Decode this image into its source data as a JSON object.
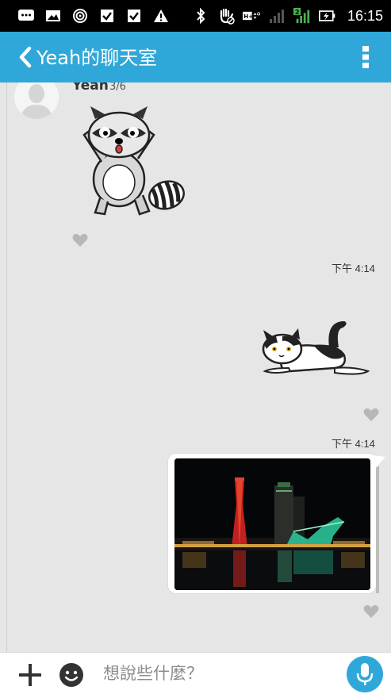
{
  "status_bar": {
    "time": "16:15",
    "icons_left": [
      "chat-bubble-icon",
      "image-icon",
      "hotspot-icon",
      "checkbox-icon",
      "checkbox-icon",
      "warning-icon"
    ],
    "icons_right": [
      "bluetooth-icon",
      "hand-icon",
      "network-hplus-icon",
      "signal-icon",
      "signal-2-icon",
      "battery-charging-icon"
    ]
  },
  "app_bar": {
    "title": "Yeah的聊天室",
    "background": "#2fa8d9"
  },
  "chat": {
    "sender": {
      "name": "Yeah",
      "count": "3/6"
    },
    "messages": [
      {
        "type": "sticker",
        "side": "left",
        "icon": "raccoon-sticker"
      },
      {
        "type": "sticker",
        "side": "right",
        "icon": "cat-sticker",
        "time": "下午 4:14"
      },
      {
        "type": "photo",
        "side": "right",
        "icon": "night-harbor-photo",
        "time": "下午 4:14"
      }
    ]
  },
  "input_bar": {
    "placeholder": "想說些什麼？",
    "accent": "#2fa8d9"
  }
}
